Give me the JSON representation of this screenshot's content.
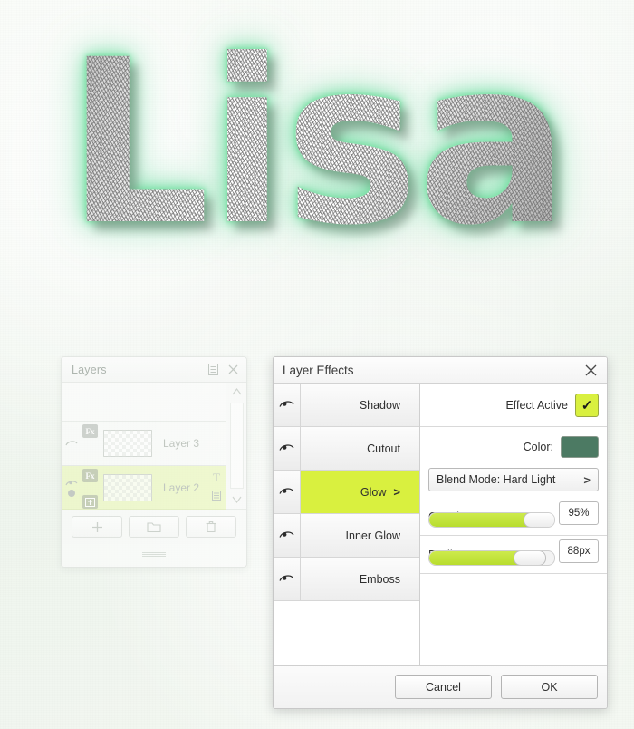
{
  "canvas": {
    "artwork_text": "Lisa",
    "background_color": "#f2f7f1",
    "glow_color": "#86e6ad"
  },
  "layers_panel": {
    "title": "Layers",
    "menu_icon": "list-icon",
    "close_icon": "close-icon",
    "scroll_up_icon": "chevron-up-icon",
    "scroll_down_icon": "chevron-down-icon",
    "rows": [
      {
        "name": "Layer 3",
        "fx_badge": "Fx",
        "selected": false,
        "has_mask": false,
        "has_text_icon": false
      },
      {
        "name": "Layer 2",
        "fx_badge": "Fx",
        "selected": true,
        "has_mask": true,
        "has_text_icon": true,
        "text_icon_label": "T"
      }
    ],
    "footer_buttons": [
      {
        "name": "add-layer-button",
        "glyph": "+"
      },
      {
        "name": "group-layers-button",
        "glyph": "folder-icon"
      },
      {
        "name": "delete-layer-button",
        "glyph": "trash-icon"
      }
    ]
  },
  "layer_effects": {
    "title": "Layer Effects",
    "close_icon": "close-icon",
    "effects": [
      {
        "label": "Shadow",
        "active": false,
        "arrow": ""
      },
      {
        "label": "Cutout",
        "active": false,
        "arrow": ""
      },
      {
        "label": "Glow",
        "active": true,
        "arrow": ">"
      },
      {
        "label": "Inner Glow",
        "active": false,
        "arrow": ""
      },
      {
        "label": "Emboss",
        "active": false,
        "arrow": ""
      }
    ],
    "effect_active": {
      "label": "Effect Active",
      "checked": true,
      "check_glyph": "✓",
      "accent_color": "#d9f03f"
    },
    "color": {
      "label": "Color:",
      "value": "#4c7a63"
    },
    "blend_mode": {
      "label": "Blend Mode: Hard Light",
      "arrow": ">"
    },
    "sliders": [
      {
        "name": "Opacity",
        "value_label": "95%",
        "percent": 88
      },
      {
        "name": "Radius",
        "value_label": "88px",
        "percent": 80
      }
    ],
    "footer": {
      "cancel_label": "Cancel",
      "ok_label": "OK"
    }
  }
}
